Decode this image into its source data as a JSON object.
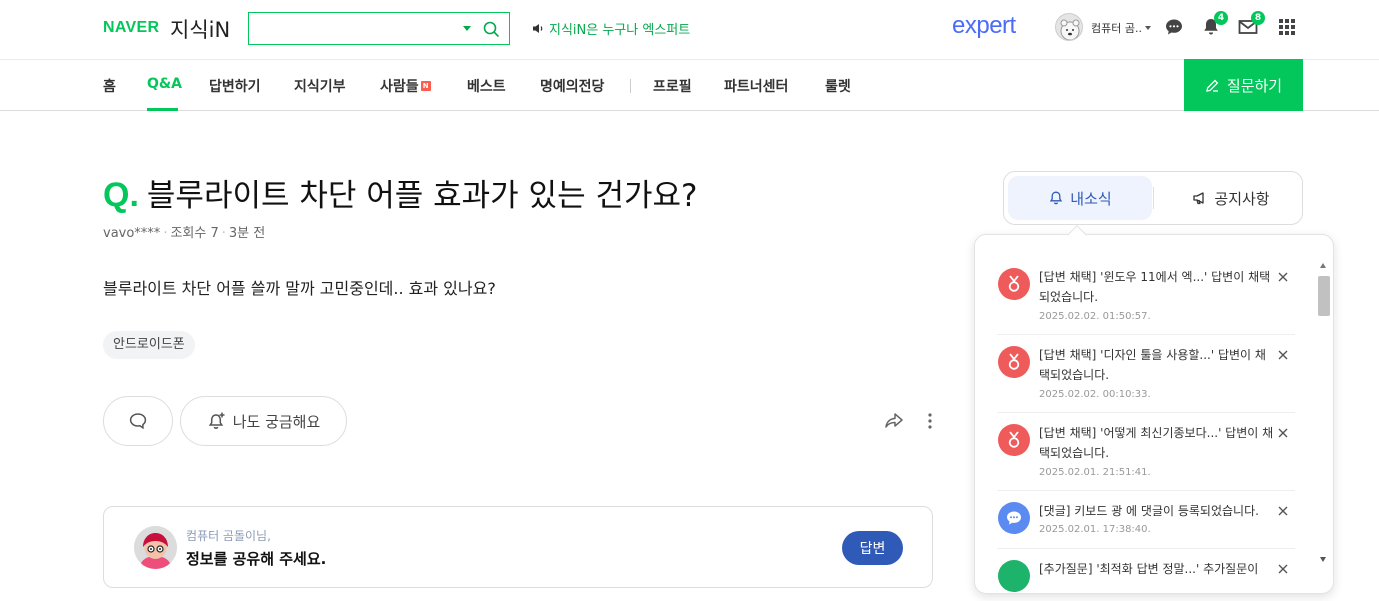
{
  "header": {
    "logo_naver": "NAVER",
    "logo_kin": "지식iN",
    "search_value": "",
    "promo_text": "지식iN은 누구나 엑스퍼트",
    "expert_logo": "expert",
    "user_name": "컴퓨터 곰..",
    "alarm_badge": "4",
    "mail_badge": "8",
    "accent_color": "#03c75a"
  },
  "nav": {
    "items": [
      {
        "label": "홈"
      },
      {
        "label": "Q&A"
      },
      {
        "label": "답변하기"
      },
      {
        "label": "지식기부"
      },
      {
        "label": "사람들"
      },
      {
        "label": "베스트"
      },
      {
        "label": "명예의전당"
      },
      {
        "label": "프로필"
      },
      {
        "label": "파트너센터"
      },
      {
        "label": "룰렛"
      }
    ],
    "people_badge": "N",
    "active": "Q&A",
    "ask_button": "질문하기"
  },
  "question": {
    "q_mark": "Q.",
    "title": "블루라이트 차단 어플 효과가 있는 건가요?",
    "author": "vavo****",
    "views": "조회수 7",
    "time": "3분 전",
    "body": "블루라이트 차단 어플 쓸까 말까 고민중인데.. 효과 있나요?",
    "tag": "안드로이드폰",
    "curious_label": "나도 궁금해요"
  },
  "answer_prompt": {
    "user": "컴퓨터 곰돌이님,",
    "message": "정보를 공유해 주세요.",
    "button": "답변"
  },
  "side": {
    "tab_news": "내소식",
    "tab_notice": "공지사항"
  },
  "notifications": [
    {
      "type": "adopt",
      "text": "[답변 채택] '윈도우 11에서 엑...' 답변이 채택되었습니다.",
      "date": "2025.02.02. 01:50:57."
    },
    {
      "type": "adopt",
      "text": "[답변 채택] '디자인 툴을 사용할...' 답변이 채택되었습니다.",
      "date": "2025.02.02. 00:10:33."
    },
    {
      "type": "adopt",
      "text": "[답변 채택] '어떻게 최신기종보다...' 답변이 채택되었습니다.",
      "date": "2025.02.01. 21:51:41."
    },
    {
      "type": "comment",
      "text": "[댓글] 키보드 광 에 댓글이 등록되었습니다.",
      "date": "2025.02.01. 17:38:40."
    },
    {
      "type": "followup",
      "text": "[추가질문] '최적화 답변 정말...' 추가질문이",
      "date": ""
    }
  ]
}
